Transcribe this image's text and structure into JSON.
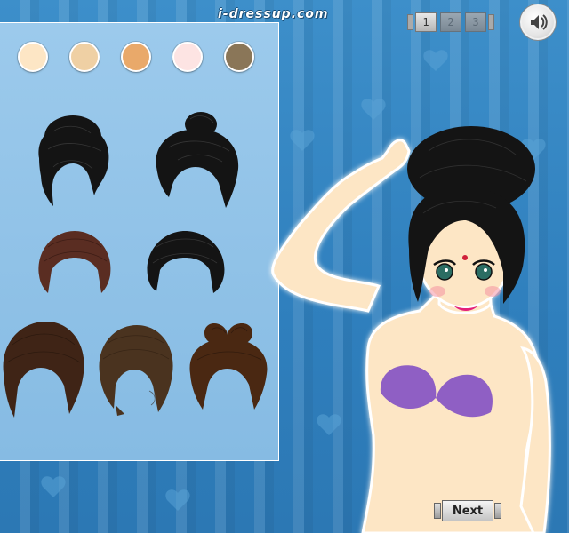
{
  "site": {
    "logo_text": "i-dressup.com"
  },
  "colors": {
    "background": "#3586c4",
    "panel": "#8fc1e6",
    "panel_border": "#ffffff"
  },
  "skin_swatches": [
    {
      "name": "skin-tone-1",
      "color": "#fde6c5"
    },
    {
      "name": "skin-tone-2",
      "color": "#efd0a4"
    },
    {
      "name": "skin-tone-3",
      "color": "#e9a96a"
    },
    {
      "name": "skin-tone-4",
      "color": "#fde4e3"
    },
    {
      "name": "skin-tone-5",
      "color": "#8a7658"
    }
  ],
  "hairstyles": [
    {
      "name": "black-messy-bun",
      "color": "#141414"
    },
    {
      "name": "black-top-bun",
      "color": "#141414"
    },
    {
      "name": "auburn-short",
      "color": "#5a2d22"
    },
    {
      "name": "black-short-bob",
      "color": "#141414"
    },
    {
      "name": "brown-swept",
      "color": "#3f2416"
    },
    {
      "name": "brown-braided",
      "color": "#4a331f"
    },
    {
      "name": "brown-bow-bun",
      "color": "#4a2812"
    }
  ],
  "pager": {
    "pages": [
      "1",
      "2",
      "3"
    ],
    "active": "1"
  },
  "buttons": {
    "next_label": "Next"
  },
  "model": {
    "skin": "#fde6c5",
    "hair": "#141414",
    "top": "#8f5fc4"
  }
}
